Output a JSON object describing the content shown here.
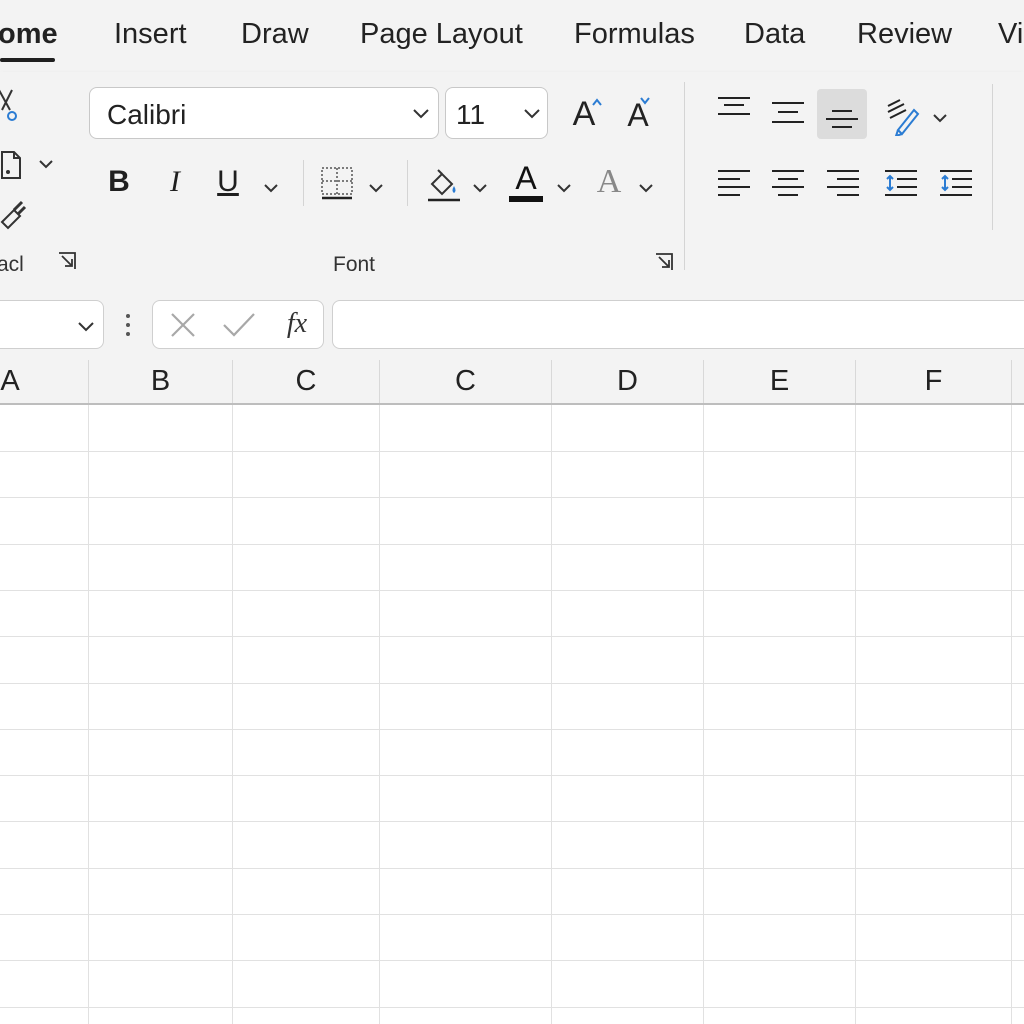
{
  "tabs": [
    {
      "label": "ome",
      "active": true
    },
    {
      "label": "Insert"
    },
    {
      "label": "Draw"
    },
    {
      "label": "Page Layout"
    },
    {
      "label": "Formulas"
    },
    {
      "label": "Data"
    },
    {
      "label": "Review"
    },
    {
      "label": "Vi"
    }
  ],
  "clipboard": {
    "group_label": "acl",
    "icons": [
      "cut-icon",
      "copy-icon",
      "format-painter-icon"
    ]
  },
  "font": {
    "group_label": "Font",
    "font_name": "Calibri",
    "font_size": "11",
    "bold_label": "B",
    "italic_label": "I",
    "underline_label": "U",
    "grow_label": "A",
    "shrink_label": "A",
    "font_color_label": "A",
    "effects_label": "A",
    "font_color": "#111111",
    "accent": "#2b7cd3"
  },
  "alignment": {
    "icons": [
      "align-top-icon",
      "align-middle-icon",
      "align-bottom-icon",
      "orientation-icon",
      "align-left-icon",
      "align-center-icon",
      "align-right-icon",
      "decrease-indent-icon",
      "increase-indent-icon"
    ]
  },
  "formula_bar": {
    "name_box_value": "",
    "fx_label": "fx",
    "formula_value": ""
  },
  "columns": [
    "A",
    "B",
    "C",
    "C",
    "D",
    "E",
    "F"
  ]
}
